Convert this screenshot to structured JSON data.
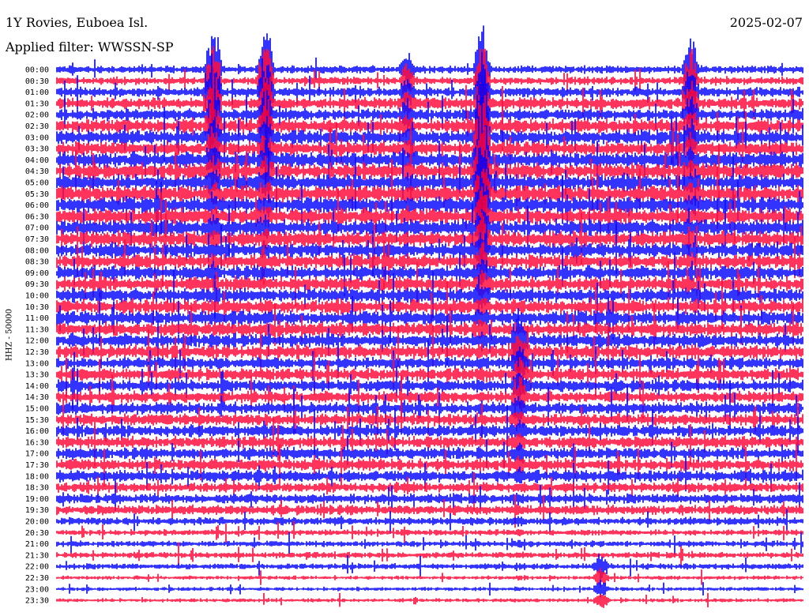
{
  "header": {
    "station": "1Y Rovies, Euboea Isl.",
    "date": "2025-02-07",
    "filter_text": "Applied filter: WWSSN-SP"
  },
  "chart_data": {
    "type": "line",
    "title": "1Y Rovies, Euboea Isl.",
    "ylabel": "HHZ - 50000",
    "xlabel": "",
    "colors": [
      "#0000ff",
      "#ff0033"
    ],
    "grid": false,
    "legend": "none",
    "row_interval_minutes": 30,
    "time_labels": [
      "00:00",
      "00:30",
      "01:00",
      "01:30",
      "02:00",
      "02:30",
      "03:00",
      "03:30",
      "04:00",
      "04:30",
      "05:00",
      "05:30",
      "06:00",
      "06:30",
      "07:00",
      "07:30",
      "08:00",
      "08:30",
      "09:00",
      "09:30",
      "10:00",
      "10:30",
      "11:00",
      "11:30",
      "12:00",
      "12:30",
      "13:00",
      "13:30",
      "14:00",
      "14:30",
      "15:00",
      "15:30",
      "16:00",
      "16:30",
      "17:00",
      "17:30",
      "18:00",
      "18:30",
      "19:00",
      "19:30",
      "20:00",
      "20:30",
      "21:00",
      "21:30",
      "22:00",
      "22:30",
      "23:00",
      "23:30"
    ],
    "noise_amplitude": [
      4,
      4,
      5,
      6,
      6,
      7,
      7,
      7,
      8,
      8,
      8,
      8,
      8,
      8,
      8,
      8,
      7,
      7,
      7,
      7,
      7,
      7,
      7,
      7,
      7,
      7,
      6,
      6,
      6,
      6,
      6,
      6,
      6,
      6,
      6,
      6,
      6,
      5,
      5,
      5,
      4,
      3,
      3,
      3,
      3,
      2,
      2,
      2
    ],
    "events": [
      {
        "time": "00:00",
        "x": 0.47,
        "amplitude": 30
      },
      {
        "time": "00:00",
        "x": 0.57,
        "amplitude": 80
      },
      {
        "time": "00:00",
        "x": 0.85,
        "amplitude": 60
      },
      {
        "time": "00:00",
        "x": 0.21,
        "amplitude": 90
      },
      {
        "time": "00:00",
        "x": 0.28,
        "amplitude": 90
      },
      {
        "time": "03:00",
        "x": 0.57,
        "amplitude": 120
      },
      {
        "time": "12:00",
        "x": 0.62,
        "amplitude": 50
      },
      {
        "time": "22:00",
        "x": 0.73,
        "amplitude": 20
      }
    ]
  }
}
